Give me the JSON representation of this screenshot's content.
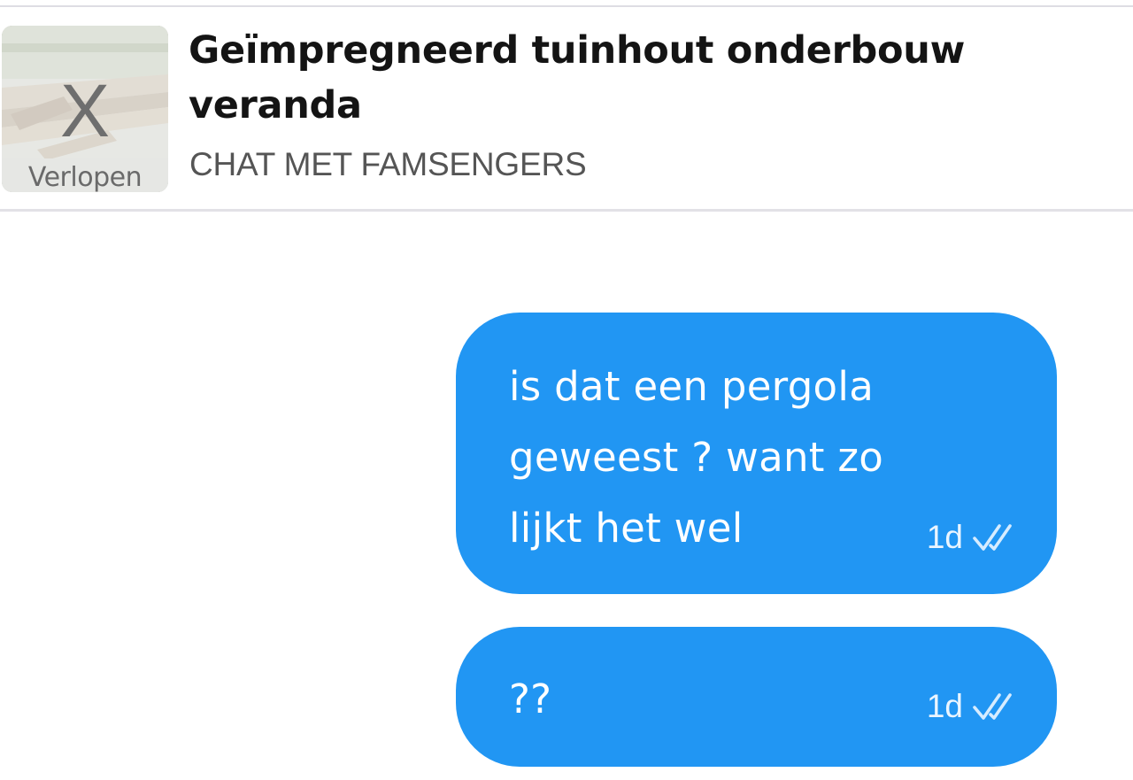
{
  "listing": {
    "title": "Geïmpregneerd tuinhout onderbouw veranda",
    "subtitle": "CHAT MET FAMSENGERS",
    "thumbnail_mark": "X",
    "status": "Verlopen"
  },
  "messages": [
    {
      "text": "is dat een pergola geweest ? want zo lijkt het wel",
      "time": "1d",
      "status_icon": "double-check-icon",
      "read": true
    },
    {
      "text": "??",
      "time": "1d",
      "status_icon": "double-check-icon",
      "read": true
    }
  ],
  "colors": {
    "bubble": "#2196f3",
    "bubble_text": "#ffffff",
    "title": "#141414",
    "subtitle": "#555555",
    "divider": "#e2e1e6"
  }
}
